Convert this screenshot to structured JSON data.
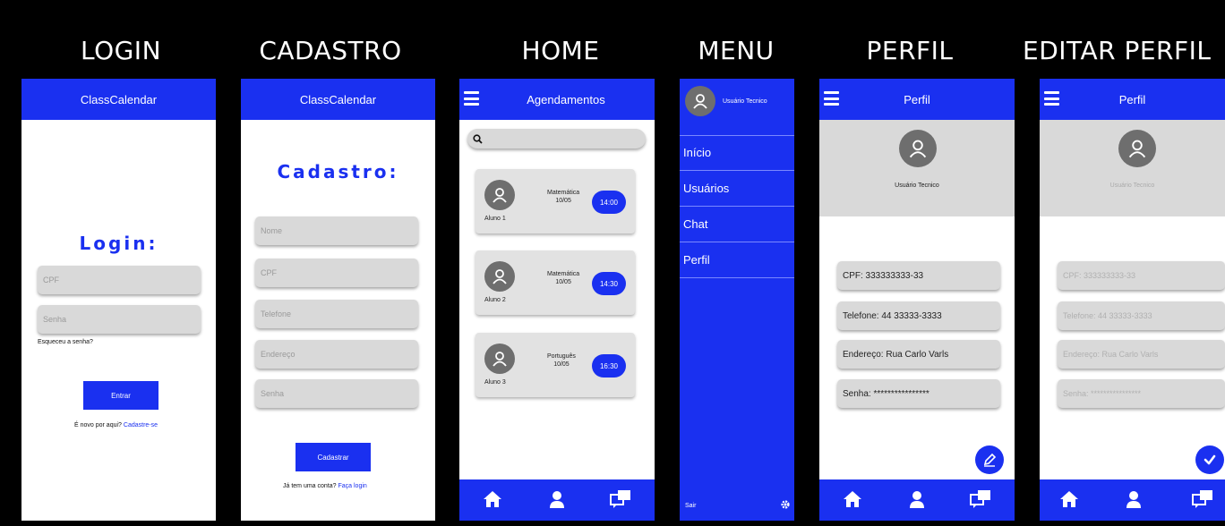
{
  "titles": {
    "login": "LOGIN",
    "cadastro": "CADASTRO",
    "home": "HOME",
    "menu": "MENU",
    "perfil": "PERFIL",
    "editar": "EDITAR PERFIL"
  },
  "colors": {
    "primary": "#1a30f0",
    "field": "#d9d9d9",
    "avatar": "#6e6e6e"
  },
  "login": {
    "app_title": "ClassCalendar",
    "heading": "Login:",
    "cpf_placeholder": "CPF",
    "senha_placeholder": "Senha",
    "forgot": "Esqueceu a senha?",
    "button": "Entrar",
    "new_prefix": "É novo por aqui?",
    "new_link": "Cadastre-se"
  },
  "cadastro": {
    "app_title": "ClassCalendar",
    "heading": "Cadastro:",
    "fields": [
      "Nome",
      "CPF",
      "Telefone",
      "Endereço",
      "Senha"
    ],
    "button": "Cadastrar",
    "have_prefix": "Já tem uma conta?",
    "have_link": "Faça login"
  },
  "home": {
    "title": "Agendamentos",
    "search_icon": "search-icon",
    "cards": [
      {
        "subject": "Matemática",
        "date": "10/05",
        "time": "14:00",
        "student": "Aluno 1"
      },
      {
        "subject": "Matemática",
        "date": "10/05",
        "time": "14:30",
        "student": "Aluno 2"
      },
      {
        "subject": "Português",
        "date": "10/05",
        "time": "16:30",
        "student": "Aluno 3"
      }
    ],
    "nav_icons": [
      "home-icon",
      "user-icon",
      "chat-icon"
    ]
  },
  "menu": {
    "user": "Usuário Tecnico",
    "items": [
      "Início",
      "Usuários",
      "Chat",
      "Perfil"
    ],
    "exit": "Sair",
    "settings_icon": "gear-icon"
  },
  "perfil": {
    "title": "Perfil",
    "user": "Usuário Tecnico",
    "cpf": "CPF: 333333333-33",
    "telefone": "Telefone: 44 33333-3333",
    "endereco": "Endereço: Rua Carlo Varls",
    "senha": "Senha: ****************",
    "fab_icon": "edit-icon"
  },
  "editar": {
    "title": "Perfil",
    "user": "Usuário Tecnico",
    "cpf": "CPF: 333333333-33",
    "telefone": "Telefone: 44 33333-3333",
    "endereco": "Endereço: Rua Carlo Varls",
    "senha": "Senha: ****************",
    "fab_icon": "check-icon"
  }
}
